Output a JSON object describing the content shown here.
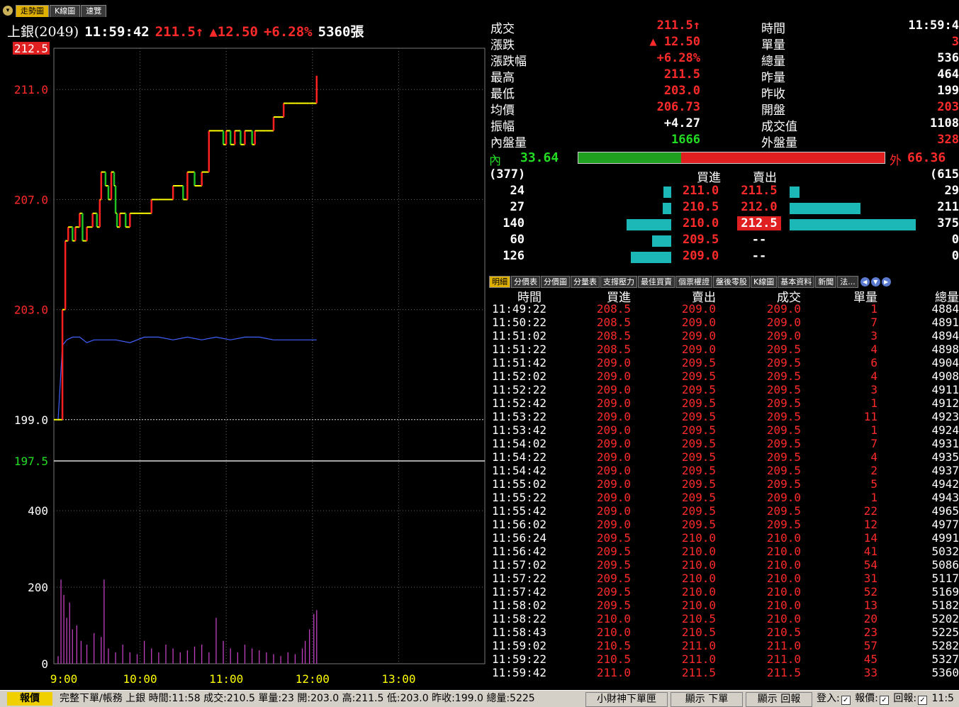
{
  "tabs": [
    {
      "label": "走勢圖",
      "active": true
    },
    {
      "label": "K線圖",
      "active": false
    },
    {
      "label": "速覽",
      "active": false
    }
  ],
  "quote": {
    "name": "上銀(2049)",
    "time": "11:59:42",
    "price": "211.5↑",
    "change": "▲12.50",
    "pct": "+6.28%",
    "volume": "5360張"
  },
  "chart_data": {
    "type": "line",
    "price_axis": {
      "ticks": [
        "212.5",
        "211.0",
        "207.0",
        "203.0",
        "199.0",
        "197.5"
      ],
      "max": 212.5,
      "min": 197.5,
      "ref": 199.0
    },
    "volume_axis": {
      "ticks": [
        "400",
        "200",
        "0"
      ],
      "max": 530,
      "min": 0
    },
    "time_axis": [
      "9:00",
      "10:00",
      "11:00",
      "12:00",
      "13:00"
    ],
    "price_series": {
      "x": [
        0,
        3,
        5,
        7,
        10,
        12,
        15,
        17,
        20,
        24,
        27,
        29,
        30,
        32,
        33,
        35,
        37,
        39,
        40,
        41,
        43,
        45,
        47,
        50,
        55,
        60,
        65,
        70,
        80,
        85,
        87,
        90,
        95,
        100,
        105,
        110,
        115,
        117,
        120,
        123,
        125,
        127,
        130,
        133,
        135,
        137,
        140,
        145,
        150,
        155,
        157,
        160,
        165,
        170,
        175,
        180
      ],
      "y": [
        199.0,
        203.0,
        205.5,
        206.0,
        205.5,
        206.0,
        206.5,
        205.5,
        206.0,
        206.5,
        206.0,
        207.0,
        208.0,
        208.0,
        207.5,
        207.0,
        208.0,
        207.5,
        206.5,
        206.0,
        206.5,
        206.5,
        206.0,
        206.5,
        206.5,
        206.5,
        207.0,
        207.0,
        207.5,
        207.5,
        207.0,
        208.0,
        207.5,
        208.0,
        209.5,
        209.5,
        209.0,
        209.5,
        209.0,
        209.5,
        209.5,
        209.0,
        209.5,
        209.5,
        209.0,
        209.5,
        209.5,
        209.5,
        210.0,
        210.0,
        210.5,
        210.5,
        210.5,
        210.5,
        210.5,
        211.5
      ]
    },
    "avg_series": {
      "x": [
        0,
        3,
        6,
        10,
        15,
        20,
        25,
        30,
        40,
        50,
        60,
        70,
        80,
        90,
        100,
        110,
        120,
        130,
        140,
        150,
        160,
        170,
        180
      ],
      "y": [
        199.0,
        201.7,
        201.9,
        202.0,
        202.0,
        201.8,
        201.9,
        201.9,
        201.9,
        201.8,
        202.0,
        202.0,
        201.9,
        202.0,
        201.9,
        202.0,
        201.9,
        202.0,
        202.0,
        201.9,
        201.9,
        201.9,
        201.9
      ]
    },
    "volume_series": {
      "x": [
        0,
        2,
        4,
        6,
        8,
        10,
        13,
        16,
        20,
        25,
        30,
        32,
        35,
        40,
        45,
        50,
        55,
        60,
        65,
        70,
        75,
        80,
        85,
        90,
        95,
        100,
        105,
        110,
        115,
        120,
        125,
        130,
        135,
        140,
        145,
        150,
        155,
        160,
        165,
        170,
        172,
        175,
        178,
        180
      ],
      "values": [
        20,
        220,
        180,
        120,
        160,
        90,
        100,
        60,
        50,
        80,
        70,
        220,
        40,
        30,
        50,
        30,
        25,
        60,
        40,
        30,
        50,
        40,
        30,
        35,
        45,
        50,
        30,
        120,
        60,
        40,
        30,
        50,
        40,
        35,
        30,
        25,
        20,
        30,
        25,
        40,
        60,
        90,
        130,
        140
      ]
    }
  },
  "info": {
    "left": [
      {
        "label": "成交",
        "value": "211.5↑",
        "color": "red"
      },
      {
        "label": "漲跌",
        "value": "▲ 12.50",
        "color": "red"
      },
      {
        "label": "漲跌幅",
        "value": "+6.28%",
        "color": "red"
      },
      {
        "label": "最高",
        "value": "211.5",
        "color": "red"
      },
      {
        "label": "最低",
        "value": "203.0",
        "color": "red"
      },
      {
        "label": "均價",
        "value": "206.73",
        "color": "red"
      },
      {
        "label": "振幅",
        "value": "+4.27",
        "color": "white"
      },
      {
        "label": "內盤量",
        "value": "1666",
        "color": "green"
      }
    ],
    "right": [
      {
        "label": "時間",
        "value": "11:59:4",
        "color": "white"
      },
      {
        "label": "單量",
        "value": "3",
        "color": "red"
      },
      {
        "label": "總量",
        "value": "536",
        "color": "white"
      },
      {
        "label": "昨量",
        "value": "464",
        "color": "white"
      },
      {
        "label": "昨收",
        "value": "199",
        "color": "white"
      },
      {
        "label": "開盤",
        "value": "203",
        "color": "red"
      },
      {
        "label": "成交值",
        "value": "1108",
        "color": "white"
      },
      {
        "label": "外盤量",
        "value": "328",
        "color": "red"
      }
    ]
  },
  "ratio": {
    "inner_label": "內",
    "inner_pct": "33.64",
    "inner_value": 33.64,
    "outer_label": "外",
    "outer_pct": "66.36"
  },
  "orderbook": {
    "header": {
      "bid_total": "(377)",
      "bid_label": "買進",
      "ask_label": "賣出",
      "ask_total": "(615"
    },
    "rows": [
      {
        "bid_qty": "24",
        "bid_price": "211.0",
        "ask_price": "211.5",
        "ask_qty": "29",
        "bid_len": 24,
        "ask_len": 29,
        "ask_highlight": false
      },
      {
        "bid_qty": "27",
        "bid_price": "210.5",
        "ask_price": "212.0",
        "ask_qty": "211",
        "bid_len": 27,
        "ask_len": 211,
        "ask_highlight": false
      },
      {
        "bid_qty": "140",
        "bid_price": "210.0",
        "ask_price": "212.5",
        "ask_qty": "375",
        "bid_len": 140,
        "ask_len": 375,
        "ask_highlight": true
      },
      {
        "bid_qty": "60",
        "bid_price": "209.5",
        "ask_price": "--",
        "ask_qty": "0",
        "bid_len": 60,
        "ask_len": 0,
        "ask_highlight": false
      },
      {
        "bid_qty": "126",
        "bid_price": "209.0",
        "ask_price": "--",
        "ask_qty": "0",
        "bid_len": 126,
        "ask_len": 0,
        "ask_highlight": false
      }
    ]
  },
  "detail_tabs": [
    "明細",
    "分價表",
    "分價圖",
    "分量表",
    "支撐壓力",
    "最佳買賣",
    "個票權證",
    "盤後零股",
    "K線圖",
    "基本資料",
    "新聞",
    "法..."
  ],
  "detail": {
    "headers": [
      "時間",
      "買進",
      "賣出",
      "成交",
      "單量",
      "總量"
    ],
    "rows": [
      [
        "11:49:22",
        "208.5",
        "209.0",
        "209.0",
        "1",
        "4884"
      ],
      [
        "11:50:22",
        "208.5",
        "209.0",
        "209.0",
        "7",
        "4891"
      ],
      [
        "11:51:02",
        "208.5",
        "209.0",
        "209.0",
        "3",
        "4894"
      ],
      [
        "11:51:22",
        "208.5",
        "209.0",
        "209.5",
        "4",
        "4898"
      ],
      [
        "11:51:42",
        "209.0",
        "209.5",
        "209.5",
        "6",
        "4904"
      ],
      [
        "11:52:02",
        "209.0",
        "209.5",
        "209.5",
        "4",
        "4908"
      ],
      [
        "11:52:22",
        "209.0",
        "209.5",
        "209.5",
        "3",
        "4911"
      ],
      [
        "11:52:42",
        "209.0",
        "209.5",
        "209.5",
        "1",
        "4912"
      ],
      [
        "11:53:22",
        "209.0",
        "209.5",
        "209.5",
        "11",
        "4923"
      ],
      [
        "11:53:42",
        "209.0",
        "209.5",
        "209.5",
        "1",
        "4924"
      ],
      [
        "11:54:02",
        "209.0",
        "209.5",
        "209.5",
        "7",
        "4931"
      ],
      [
        "11:54:22",
        "209.0",
        "209.5",
        "209.5",
        "4",
        "4935"
      ],
      [
        "11:54:42",
        "209.0",
        "209.5",
        "209.5",
        "2",
        "4937"
      ],
      [
        "11:55:02",
        "209.0",
        "209.5",
        "209.5",
        "5",
        "4942"
      ],
      [
        "11:55:22",
        "209.0",
        "209.5",
        "209.0",
        "1",
        "4943"
      ],
      [
        "11:55:42",
        "209.0",
        "209.5",
        "209.5",
        "22",
        "4965"
      ],
      [
        "11:56:02",
        "209.0",
        "209.5",
        "209.5",
        "12",
        "4977"
      ],
      [
        "11:56:24",
        "209.5",
        "210.0",
        "210.0",
        "14",
        "4991"
      ],
      [
        "11:56:42",
        "209.5",
        "210.0",
        "210.0",
        "41",
        "5032"
      ],
      [
        "11:57:02",
        "209.5",
        "210.0",
        "210.0",
        "54",
        "5086"
      ],
      [
        "11:57:22",
        "209.5",
        "210.0",
        "210.0",
        "31",
        "5117"
      ],
      [
        "11:57:42",
        "209.5",
        "210.0",
        "210.0",
        "52",
        "5169"
      ],
      [
        "11:58:02",
        "209.5",
        "210.0",
        "210.0",
        "13",
        "5182"
      ],
      [
        "11:58:22",
        "210.0",
        "210.5",
        "210.0",
        "20",
        "5202"
      ],
      [
        "11:58:43",
        "210.0",
        "210.5",
        "210.5",
        "23",
        "5225"
      ],
      [
        "11:59:02",
        "210.5",
        "211.0",
        "211.0",
        "57",
        "5282"
      ],
      [
        "11:59:22",
        "210.5",
        "211.0",
        "211.0",
        "45",
        "5327"
      ],
      [
        "11:59:42",
        "211.0",
        "211.5",
        "211.5",
        "33",
        "5360"
      ]
    ],
    "green_qty_rows": [
      14,
      23
    ]
  },
  "statusbar": {
    "tab": "報價",
    "ticker": "完整下單/帳務 上銀 時間:11:58 成交:210.5 單量:23 開:203.0 高:211.5 低:203.0 昨收:199.0 總量:5225",
    "buttons": [
      "小財神下單匣",
      "顯示 下單",
      "顯示 回報"
    ],
    "login": "登入:",
    "quote_chk": "報價:",
    "report_chk": "回報:",
    "time": "11:5"
  },
  "colors": {
    "up": "#ff2a2a",
    "down": "#22dd22",
    "bar": "#1cb8b8",
    "volume": "#c040c0",
    "avg": "#4060ff"
  }
}
